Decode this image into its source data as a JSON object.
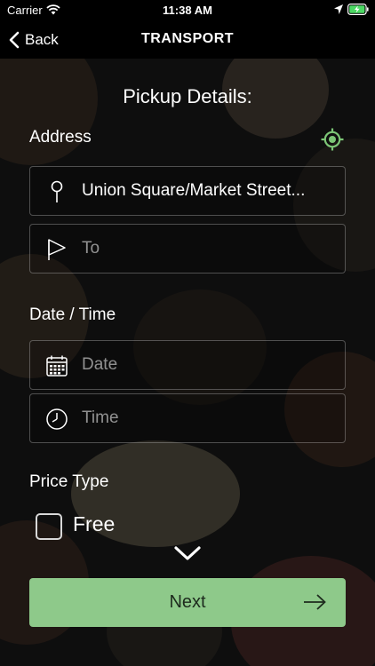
{
  "status_bar": {
    "carrier": "Carrier",
    "time": "11:38 AM",
    "icons": [
      "wifi-icon",
      "location-arrow-icon",
      "battery-charging-icon"
    ]
  },
  "nav": {
    "back_label": "Back",
    "title": "TRANSPORT"
  },
  "pickup": {
    "heading": "Pickup Details:",
    "address_label": "Address",
    "from_value": "Union Square/Market Street...",
    "to_placeholder": "To",
    "datetime_label": "Date / Time",
    "date_placeholder": "Date",
    "time_placeholder": "Time",
    "price_type_label": "Price Type",
    "price_option": "Free",
    "price_option_checked": false
  },
  "actions": {
    "next_label": "Next"
  },
  "colors": {
    "accent": "#8ec98a",
    "location_icon": "#7cc576",
    "background": "#000000"
  }
}
